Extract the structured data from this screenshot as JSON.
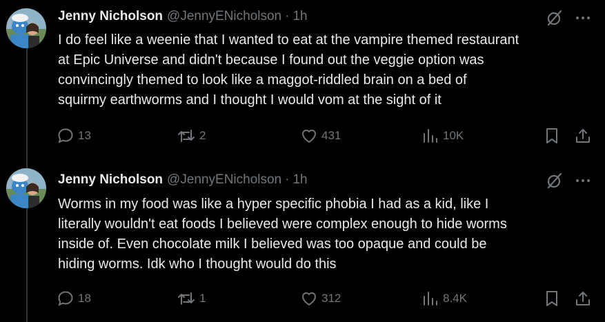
{
  "tweets": [
    {
      "author_name": "Jenny Nicholson",
      "handle": "@JennyENicholson",
      "separator": "·",
      "time": "1h",
      "text": "I do feel like a weenie that I wanted to eat at the vampire themed restaurant\nat Epic Universe and didn't because I found out the veggie option was\nconvincingly themed to look like a maggot-riddled brain on a bed of\nsquirmy earthworms and I thought I would vom at the sight of it",
      "replies": "13",
      "reposts": "2",
      "likes": "431",
      "views": "10K"
    },
    {
      "author_name": "Jenny Nicholson",
      "handle": "@JennyENicholson",
      "separator": "·",
      "time": "1h",
      "text": "Worms in my food was like a hyper specific phobia I had as a kid, like I\nliterally wouldn't eat foods I believed were complex enough to hide worms\ninside of. Even chocolate milk I believed was too opaque and could be\nhiding worms. Idk who I thought would do this",
      "replies": "18",
      "reposts": "1",
      "likes": "312",
      "views": "8.4K"
    }
  ],
  "icons": {
    "reply": "speech-bubble-icon",
    "repost": "repost-arrows-icon",
    "like": "heart-icon",
    "views": "bar-chart-icon",
    "bookmark": "bookmark-icon",
    "share": "share-upload-icon",
    "grok": "grok-slash-icon",
    "more": "more-dots-icon"
  },
  "colors": {
    "background": "#000000",
    "text_primary": "#e7e9ea",
    "text_secondary": "#71767b",
    "thread_line": "#333639"
  }
}
